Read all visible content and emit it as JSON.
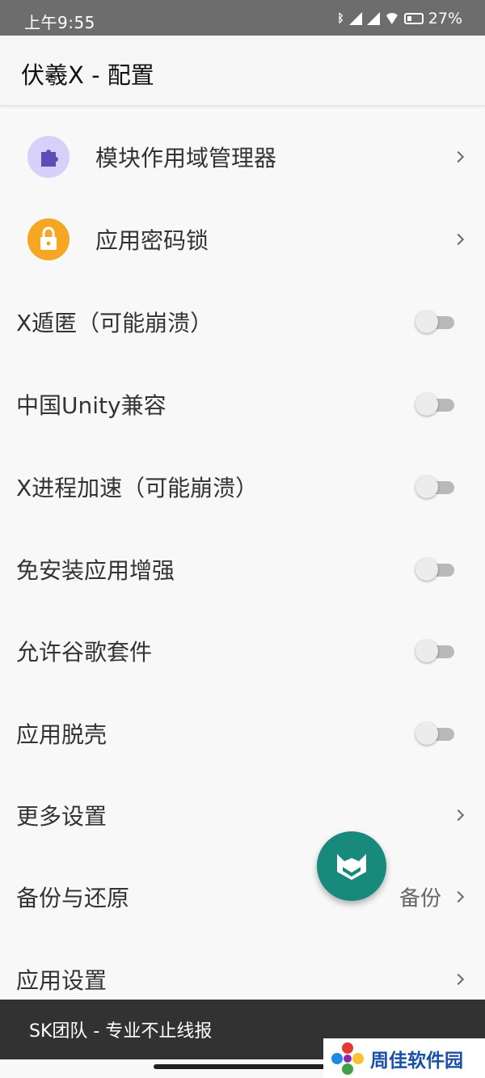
{
  "status_bar": {
    "time": "上午9:55",
    "battery_percent": "27%",
    "icons": [
      "bluetooth-icon",
      "signal-icon",
      "signal-icon",
      "wifi-icon",
      "battery-icon"
    ]
  },
  "app_bar": {
    "title": "伏羲X - 配置"
  },
  "items": [
    {
      "label": "模块作用域管理器",
      "type": "nav",
      "icon": "puzzle-icon",
      "icon_color": "#d6d0fa"
    },
    {
      "label": "应用密码锁",
      "type": "nav",
      "icon": "lock-icon",
      "icon_color": "#f5a724"
    },
    {
      "label": "X遁匿（可能崩溃）",
      "type": "toggle",
      "checked": false
    },
    {
      "label": "中国Unity兼容",
      "type": "toggle",
      "checked": false
    },
    {
      "label": "X进程加速（可能崩溃）",
      "type": "toggle",
      "checked": false
    },
    {
      "label": "免安装应用增强",
      "type": "toggle",
      "checked": false
    },
    {
      "label": "允许谷歌套件",
      "type": "toggle",
      "checked": false
    },
    {
      "label": "应用脱壳",
      "type": "toggle",
      "checked": false
    },
    {
      "label": "更多设置",
      "type": "nav"
    },
    {
      "label": "备份与还原",
      "type": "nav",
      "value": "备份"
    },
    {
      "label": "应用设置",
      "type": "nav"
    }
  ],
  "fab": {
    "icon": "fox-icon",
    "color": "#188a7c"
  },
  "snackbar": {
    "text": "SK团队 - 专业不止线报"
  },
  "watermark": {
    "text": "周佳软件园"
  },
  "colors": {
    "accent": "#188a7c",
    "background": "#f8f8f8",
    "status_bar": "#6d6d6d",
    "snackbar": "#323232"
  }
}
